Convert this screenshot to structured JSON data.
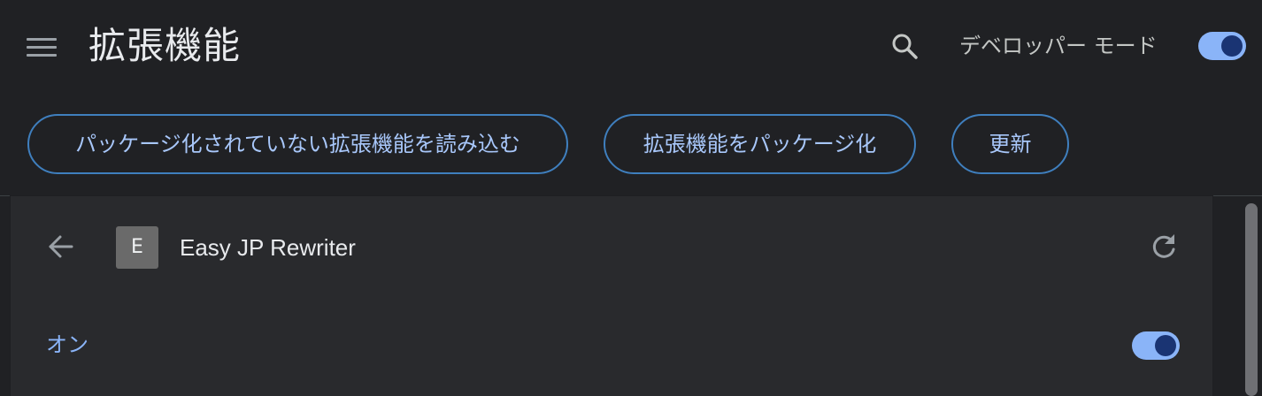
{
  "header": {
    "title": "拡張機能",
    "menu_icon": "hamburger-menu-icon",
    "search_icon": "search-icon",
    "developer_mode_label": "デベロッパー モード",
    "developer_mode_on": true
  },
  "toolbar": {
    "load_unpacked_label": "パッケージ化されていない拡張機能を読み込む",
    "pack_label": "拡張機能をパッケージ化",
    "update_label": "更新"
  },
  "detail": {
    "back_icon": "arrow-back-icon",
    "extension_icon_letter": "E",
    "extension_name": "Easy JP Rewriter",
    "reload_icon": "reload-icon",
    "enabled_label": "オン",
    "enabled": true
  },
  "colors": {
    "background": "#202124",
    "card": "#292a2d",
    "accent": "#8ab4f8",
    "pill_border": "#3f7fbe",
    "toggle_knob": "#1a3473"
  }
}
